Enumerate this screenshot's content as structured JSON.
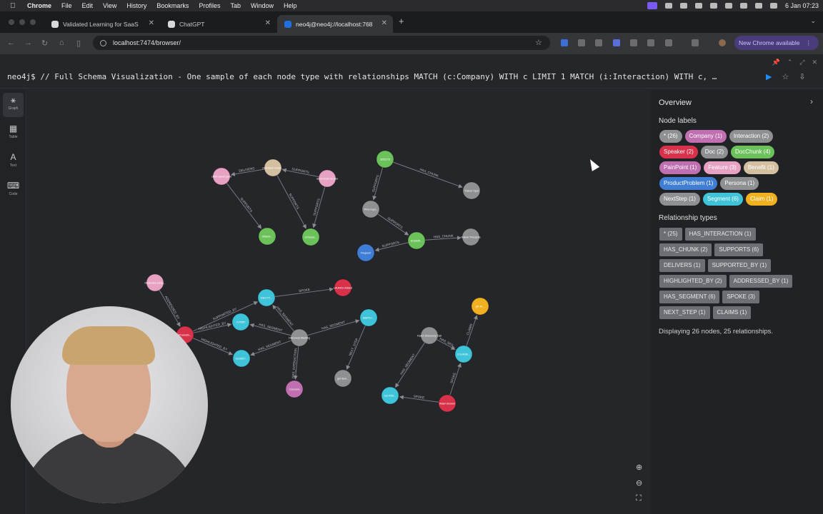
{
  "menubar": {
    "app": "Chrome",
    "items": [
      "File",
      "Edit",
      "View",
      "History",
      "Bookmarks",
      "Profiles",
      "Tab",
      "Window",
      "Help"
    ],
    "clock": "6 Jan  07:23"
  },
  "tabs": [
    {
      "title": "Validated Learning for SaaS",
      "color": "#d8d8d8"
    },
    {
      "title": "ChatGPT",
      "color": "#d8d8d8"
    },
    {
      "title": "neo4j@neo4j://localhost:768",
      "color": "#1f6fe0"
    }
  ],
  "toolbar": {
    "url": "localhost:7474/browser/",
    "new_chrome": "New Chrome available"
  },
  "neo4j": {
    "prompt": "neo4j$",
    "query": "// Full Schema Visualization - One sample of each node type with relationships MATCH (c:Company) WITH c LIMIT 1 MATCH (i:Interaction) WITH c, …",
    "sidebar": [
      "Graph",
      "Table",
      "Text",
      "Code"
    ]
  },
  "overview": {
    "title": "Overview",
    "node_labels_heading": "Node labels",
    "node_labels": [
      {
        "label": "* (26)",
        "color": "#8f9094"
      },
      {
        "label": "Company (1)",
        "color": "#c06fb0"
      },
      {
        "label": "Interaction (2)",
        "color": "#8f9094"
      },
      {
        "label": "Speaker (2)",
        "color": "#d8324a"
      },
      {
        "label": "Doc (2)",
        "color": "#8f9094"
      },
      {
        "label": "DocChunk (4)",
        "color": "#6cc25a"
      },
      {
        "label": "PainPoint (1)",
        "color": "#c06fb0"
      },
      {
        "label": "Feature (3)",
        "color": "#e7a1c3"
      },
      {
        "label": "Benefit (1)",
        "color": "#d4c0a0"
      },
      {
        "label": "ProductProblem (1)",
        "color": "#3f7ed4"
      },
      {
        "label": "Persona (1)",
        "color": "#8f9094"
      },
      {
        "label": "NextStep (1)",
        "color": "#8f9094"
      },
      {
        "label": "Segment (6)",
        "color": "#3ec3d8"
      },
      {
        "label": "Claim (1)",
        "color": "#f0b020"
      }
    ],
    "relationship_types_heading": "Relationship types",
    "relationship_types": [
      "* (25)",
      "HAS_INTERACTION (1)",
      "HAS_CHUNK (2)",
      "SUPPORTS (6)",
      "DELIVERS (1)",
      "SUPPORTED_BY (1)",
      "HIGHLIGHTED_BY (2)",
      "ADDRESSED_BY (1)",
      "HAS_SEGMENT (6)",
      "SPOKE (3)",
      "NEXT_STEP (1)",
      "CLAIMS (1)"
    ],
    "footer": "Displaying 26 nodes, 25 relationships."
  },
  "graph": {
    "nodes": [
      {
        "id": "n1",
        "label": "client asked point",
        "color": "#e7a1c3"
      },
      {
        "id": "n2",
        "label": "maintains compr...",
        "color": "#d4c0a0"
      },
      {
        "id": "n3",
        "label": "avoid close be prio",
        "color": "#e7a1c3"
      },
      {
        "id": "n4",
        "label": "005ebb...",
        "color": "#6cc25a"
      },
      {
        "id": "n5",
        "label": "a70acdd...",
        "color": "#6cc25a"
      },
      {
        "id": "n6",
        "label": "2652275",
        "color": "#6cc25a"
      },
      {
        "id": "n7",
        "label": "Trainer Spot",
        "color": "#8f9094"
      },
      {
        "id": "n8",
        "label": "Time Equi...",
        "color": "#8f9094"
      },
      {
        "id": "n9",
        "label": "813ab6f...",
        "color": "#6cc25a"
      },
      {
        "id": "n10",
        "label": "Trainer Proceeds",
        "color": "#8f9094"
      },
      {
        "id": "n11",
        "label": "Frequent",
        "color": "#3f7ed4"
      },
      {
        "id": "n12",
        "label": "Dedicated comp...",
        "color": "#e7a1c3"
      },
      {
        "id": "n13",
        "label": "LAUNCH Added",
        "color": "#d8324a"
      },
      {
        "id": "n14",
        "label": "0dec777...",
        "color": "#3ec3d8"
      },
      {
        "id": "n15",
        "label": "7c7f0ff2",
        "color": "#3ec3d8"
      },
      {
        "id": "n16",
        "label": "Productiv...",
        "color": "#d8324a"
      },
      {
        "id": "n17",
        "label": "Discovery Meeting",
        "color": "#8f9094"
      },
      {
        "id": "n18",
        "label": "8d87f17...",
        "color": "#3ec3d8"
      },
      {
        "id": "n19",
        "label": "0c1d657...",
        "color": "#3ec3d8"
      },
      {
        "id": "n20",
        "label": "Coursera",
        "color": "#c06fb0"
      },
      {
        "id": "n21",
        "label": "get dem...",
        "color": "#8f9094"
      },
      {
        "id": "n22",
        "label": "gift 4h...",
        "color": "#f0b020"
      },
      {
        "id": "n23",
        "label": "Karen Discovery Call",
        "color": "#8f9094"
      },
      {
        "id": "n24",
        "label": "17ec4c68...",
        "color": "#3ec3d8"
      },
      {
        "id": "n25",
        "label": "2ce7050...",
        "color": "#3ec3d8"
      },
      {
        "id": "n26",
        "label": "Adam Bonner",
        "color": "#d8324a"
      }
    ],
    "edges": [
      {
        "from": "n2",
        "to": "n1",
        "label": "DELIVERS"
      },
      {
        "from": "n1",
        "to": "n4",
        "label": "SUPPORTS"
      },
      {
        "from": "n2",
        "to": "n5",
        "label": "SUPPORTS"
      },
      {
        "from": "n3",
        "to": "n2",
        "label": "SUPPORTS"
      },
      {
        "from": "n3",
        "to": "n5",
        "label": "SUPPORTS"
      },
      {
        "from": "n6",
        "to": "n7",
        "label": "HAS_CHUNK"
      },
      {
        "from": "n6",
        "to": "n8",
        "label": "SUPPORTS"
      },
      {
        "from": "n8",
        "to": "n9",
        "label": "SUPPORTS"
      },
      {
        "from": "n9",
        "to": "n10",
        "label": "HAS_CHUNK"
      },
      {
        "from": "n9",
        "to": "n11",
        "label": "SUPPORTS"
      },
      {
        "from": "n12",
        "to": "n16",
        "label": "ADDRESSED_BY"
      },
      {
        "from": "n14",
        "to": "n13",
        "label": "SPOKE"
      },
      {
        "from": "n16",
        "to": "n14",
        "label": "SUPPORTED_BY"
      },
      {
        "from": "n16",
        "to": "n15",
        "label": "HIGHLIGHTED_BY"
      },
      {
        "from": "n16",
        "to": "n19",
        "label": "HIGHLIGHTED_BY"
      },
      {
        "from": "n17",
        "to": "n14",
        "label": "HAS_SEGMENT"
      },
      {
        "from": "n17",
        "to": "n15",
        "label": "HAS_SEGMENT"
      },
      {
        "from": "n17",
        "to": "n18",
        "label": "HAS_SEGMENT"
      },
      {
        "from": "n17",
        "to": "n19",
        "label": "HAS_SEGMENT"
      },
      {
        "from": "n17",
        "to": "n20",
        "label": "HAS_INTERACTION"
      },
      {
        "from": "n18",
        "to": "n21",
        "label": "NEXT_STEP"
      },
      {
        "from": "n23",
        "to": "n24",
        "label": "HAS_SEG..."
      },
      {
        "from": "n23",
        "to": "n25",
        "label": "HAS_SEGMENT"
      },
      {
        "from": "n24",
        "to": "n22",
        "label": "CLAIMS"
      },
      {
        "from": "n26",
        "to": "n24",
        "label": "SPOKE"
      },
      {
        "from": "n26",
        "to": "n25",
        "label": "SPOKE"
      }
    ]
  }
}
